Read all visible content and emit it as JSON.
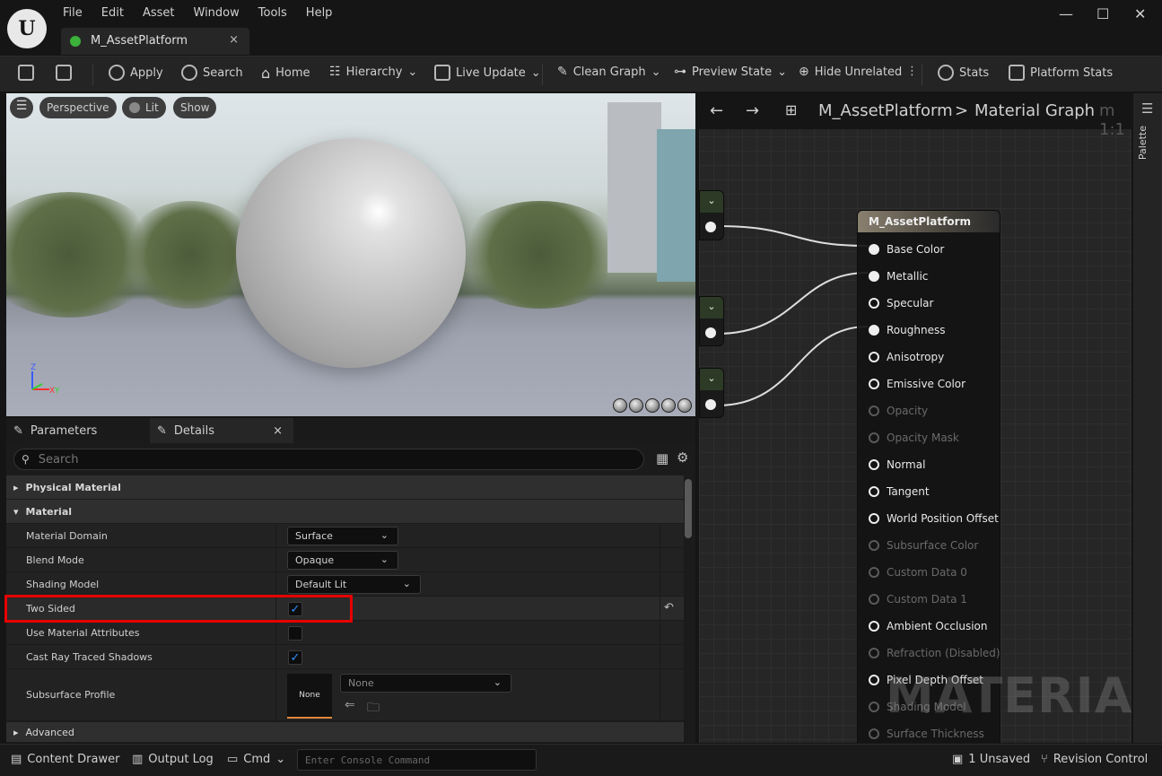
{
  "menu": [
    "File",
    "Edit",
    "Asset",
    "Window",
    "Tools",
    "Help"
  ],
  "logo": "U",
  "window_controls": {
    "minimize": "—",
    "maximize": "☐",
    "close": "✕"
  },
  "doc_tab": {
    "title": "M_AssetPlatform",
    "close": "×"
  },
  "toolbar": {
    "apply": "Apply",
    "search": "Search",
    "home": "Home",
    "hierarchy": "Hierarchy",
    "live_update": "Live Update",
    "clean_graph": "Clean Graph",
    "preview_state": "Preview State",
    "hide_unrelated": "Hide Unrelated",
    "stats": "Stats",
    "platform_stats": "Platform Stats"
  },
  "viewport": {
    "perspective": "Perspective",
    "lit": "Lit",
    "show": "Show",
    "axis_z": "Z",
    "axis_x": "X",
    "axis_y": "Y"
  },
  "panel_tabs": {
    "parameters": "Parameters",
    "details": "Details",
    "close": "×"
  },
  "details": {
    "search_placeholder": "Search",
    "categories": {
      "physical_material": "Physical Material",
      "material": "Material",
      "advanced": "Advanced"
    },
    "rows": {
      "material_domain": {
        "label": "Material Domain",
        "value": "Surface"
      },
      "blend_mode": {
        "label": "Blend Mode",
        "value": "Opaque"
      },
      "shading_model": {
        "label": "Shading Model",
        "value": "Default Lit"
      },
      "two_sided": {
        "label": "Two Sided",
        "checked": true
      },
      "use_material_attributes": {
        "label": "Use Material Attributes",
        "checked": false
      },
      "cast_ray_traced_shadows": {
        "label": "Cast Ray Traced Shadows",
        "checked": true
      },
      "subsurface_profile": {
        "label": "Subsurface Profile",
        "thumb": "None",
        "value": "None"
      }
    }
  },
  "graph": {
    "breadcrumb_asset": "M_AssetPlatform",
    "breadcrumb_sep": ">",
    "breadcrumb_graph": "Material Graph",
    "zoom_overlay": "m 1:1",
    "node_title": "M_AssetPlatform",
    "pins": [
      {
        "label": "Base Color",
        "state": "on",
        "filled": true
      },
      {
        "label": "Metallic",
        "state": "on",
        "filled": true
      },
      {
        "label": "Specular",
        "state": "on",
        "filled": false
      },
      {
        "label": "Roughness",
        "state": "on",
        "filled": true
      },
      {
        "label": "Anisotropy",
        "state": "on",
        "filled": false
      },
      {
        "label": "Emissive Color",
        "state": "on",
        "filled": false
      },
      {
        "label": "Opacity",
        "state": "off",
        "filled": false
      },
      {
        "label": "Opacity Mask",
        "state": "off",
        "filled": false
      },
      {
        "label": "Normal",
        "state": "on",
        "filled": false
      },
      {
        "label": "Tangent",
        "state": "on",
        "filled": false
      },
      {
        "label": "World Position Offset",
        "state": "on",
        "filled": false
      },
      {
        "label": "Subsurface Color",
        "state": "off",
        "filled": false
      },
      {
        "label": "Custom Data 0",
        "state": "off",
        "filled": false
      },
      {
        "label": "Custom Data 1",
        "state": "off",
        "filled": false
      },
      {
        "label": "Ambient Occlusion",
        "state": "on",
        "filled": false
      },
      {
        "label": "Refraction (Disabled)",
        "state": "off",
        "filled": false
      },
      {
        "label": "Pixel Depth Offset",
        "state": "on",
        "filled": false
      },
      {
        "label": "Shading Model",
        "state": "off",
        "filled": false
      },
      {
        "label": "Surface Thickness",
        "state": "off",
        "filled": false
      }
    ],
    "watermark": "MATERIAL"
  },
  "palette_label": "Palette",
  "status": {
    "content_drawer": "Content Drawer",
    "output_log": "Output Log",
    "cmd": "Cmd",
    "console_placeholder": "Enter Console Command",
    "unsaved": "1 Unsaved",
    "revision_control": "Revision Control"
  },
  "colors": {
    "accent_blue": "#2f8fff",
    "highlight_red": "#e60000",
    "node_input_green": "#2c3a26"
  }
}
